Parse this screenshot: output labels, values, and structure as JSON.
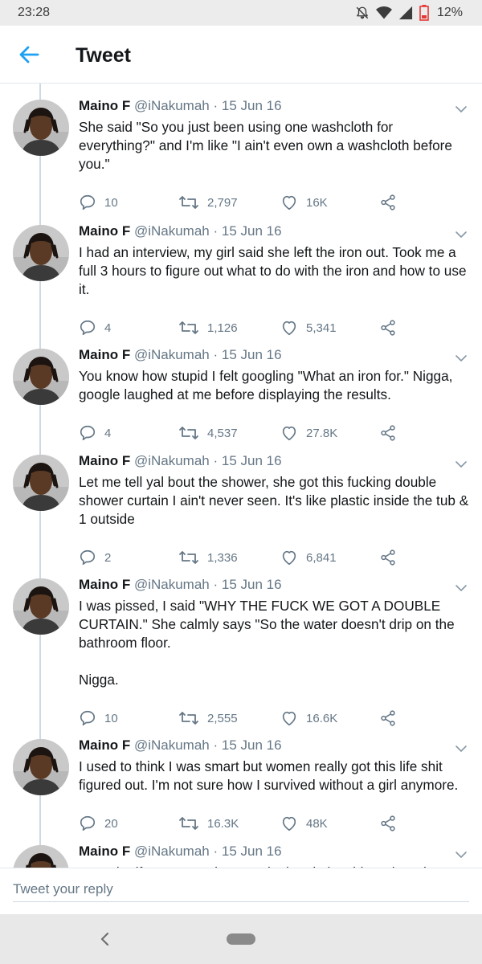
{
  "status_bar": {
    "time": "23:28",
    "battery_percent": "12%",
    "icons": [
      "mute-icon",
      "wifi-icon",
      "signal-icon",
      "battery-low-icon"
    ]
  },
  "app_bar": {
    "back_icon": "arrow-left-icon",
    "title": "Tweet"
  },
  "colors": {
    "accent": "#1da1f2",
    "text": "#14171a",
    "secondary": "#657786",
    "thread_line": "#cfd9e3"
  },
  "thread": {
    "tweets": [
      {
        "name": "Maino F",
        "handle": "@iNakumah",
        "separator": "·",
        "date": "15 Jun 16",
        "text": "She said \"So you just been using one washcloth for everything?\" and I'm like \"I ain't even own a washcloth before you.\"",
        "replies": "10",
        "retweets": "2,797",
        "likes": "16K"
      },
      {
        "name": "Maino F",
        "handle": "@iNakumah",
        "separator": "·",
        "date": "15 Jun 16",
        "text": "I had an interview, my girl said she left the iron out. Took me a full 3 hours to figure out what to do with the iron and how to use it.",
        "replies": "4",
        "retweets": "1,126",
        "likes": "5,341"
      },
      {
        "name": "Maino F",
        "handle": "@iNakumah",
        "separator": "·",
        "date": "15 Jun 16",
        "text": "You know how stupid I felt googling \"What an iron for.\" Nigga, google laughed at me before displaying the results.",
        "replies": "4",
        "retweets": "4,537",
        "likes": "27.8K"
      },
      {
        "name": "Maino F",
        "handle": "@iNakumah",
        "separator": "·",
        "date": "15 Jun 16",
        "text": "Let me tell yal bout the shower, she got this fucking double shower curtain I ain't never seen. It's like plastic inside the tub & 1 outside",
        "replies": "2",
        "retweets": "1,336",
        "likes": "6,841"
      },
      {
        "name": "Maino F",
        "handle": "@iNakumah",
        "separator": "·",
        "date": "15 Jun 16",
        "text": "I was pissed, I said \"WHY THE FUCK WE GOT A DOUBLE CURTAIN.\" She calmly says \"So the water doesn't drip on the bathroom floor.\n\nNigga.",
        "replies": "10",
        "retweets": "2,555",
        "likes": "16.6K"
      },
      {
        "name": "Maino F",
        "handle": "@iNakumah",
        "separator": "·",
        "date": "15 Jun 16",
        "text": "I used to think I was smart but women really got this life shit figured out. I'm not sure how I survived without a girl anymore.",
        "replies": "20",
        "retweets": "16.3K",
        "likes": "48K"
      },
      {
        "name": "Maino F",
        "handle": "@iNakumah",
        "separator": "·",
        "date": "15 Jun 16",
        "text": "I wonder if every man has a point in relationships where he",
        "replies": "",
        "retweets": "",
        "likes": ""
      }
    ]
  },
  "reply_bar": {
    "placeholder": "Tweet your reply"
  },
  "nav_bar": {
    "back_icon": "nav-back-icon",
    "home_icon": "home-pill-icon"
  }
}
